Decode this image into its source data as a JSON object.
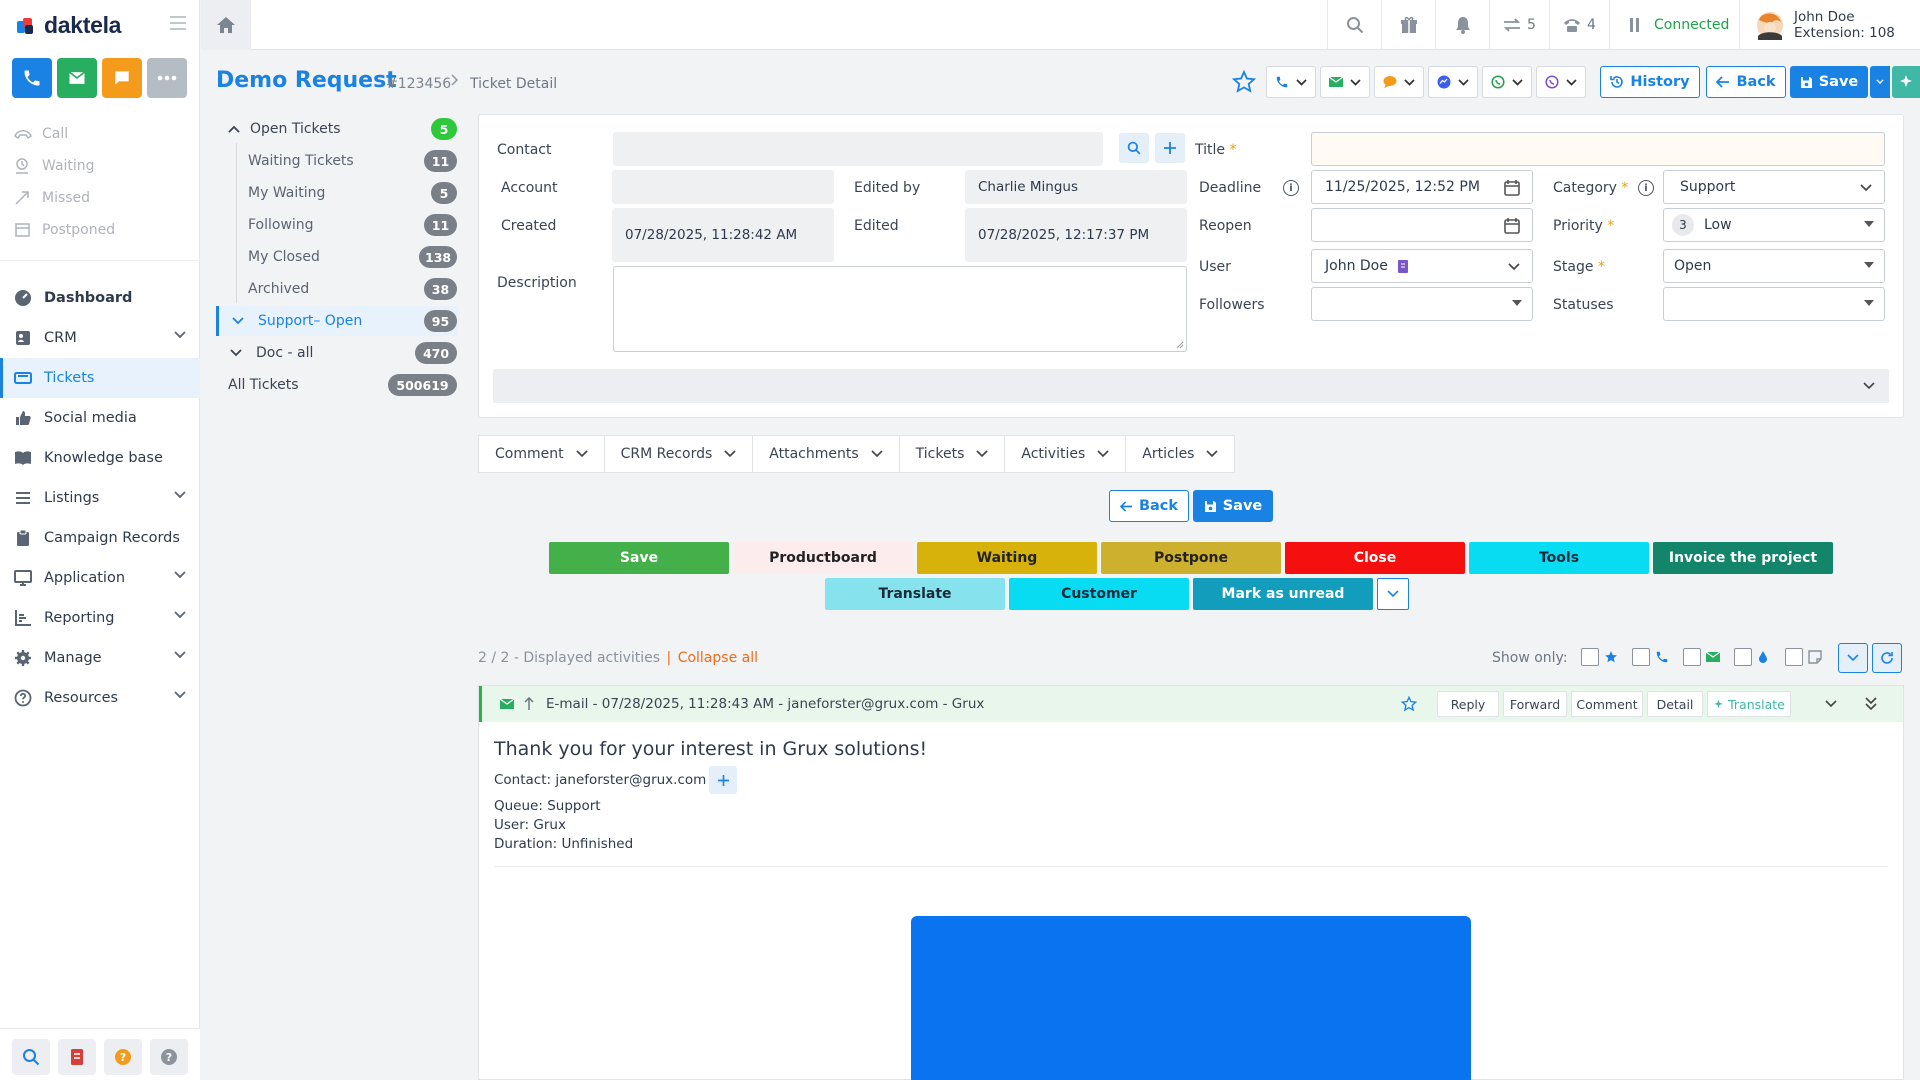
{
  "app": {
    "name": "daktela"
  },
  "sidebar": {
    "old_items": [
      {
        "label": "Call"
      },
      {
        "label": "Waiting"
      },
      {
        "label": "Missed"
      },
      {
        "label": "Postponed"
      }
    ],
    "nav": [
      {
        "label": "Dashboard",
        "icon": "dashboard-icon",
        "expandable": false
      },
      {
        "label": "CRM",
        "icon": "contact-card-icon",
        "expandable": true
      },
      {
        "label": "Tickets",
        "icon": "ticket-icon",
        "expandable": false,
        "active": true
      },
      {
        "label": "Social media",
        "icon": "thumbs-up-icon",
        "expandable": false
      },
      {
        "label": "Knowledge base",
        "icon": "book-icon",
        "expandable": false
      },
      {
        "label": "Listings",
        "icon": "list-icon",
        "expandable": true
      },
      {
        "label": "Campaign Records",
        "icon": "clipboard-icon",
        "expandable": false
      },
      {
        "label": "Application",
        "icon": "monitor-icon",
        "expandable": true
      },
      {
        "label": "Reporting",
        "icon": "chart-icon",
        "expandable": true
      },
      {
        "label": "Manage",
        "icon": "gear-icon",
        "expandable": true
      },
      {
        "label": "Resources",
        "icon": "help-circle-icon",
        "expandable": true
      }
    ]
  },
  "topbar": {
    "transfers_count": "5",
    "calls_count": "4",
    "status": "Connected",
    "user_name": "John Doe",
    "extension": "Extension: 108"
  },
  "page": {
    "title": "Demo Request",
    "ticket_number": "#123456",
    "breadcrumb": "Ticket Detail",
    "history_label": "History",
    "back_label": "Back",
    "save_label": "Save"
  },
  "ticket_tree": [
    {
      "label": "Open Tickets",
      "count": "5"
    },
    {
      "label": "Waiting Tickets",
      "count": "11"
    },
    {
      "label": "My Waiting",
      "count": "5"
    },
    {
      "label": "Following",
      "count": "11"
    },
    {
      "label": "My Closed",
      "count": "138"
    },
    {
      "label": "Archived",
      "count": "38"
    },
    {
      "label": "Support– Open",
      "count": "95"
    },
    {
      "label": "Doc - all",
      "count": "470"
    },
    {
      "label": "All Tickets",
      "count": "500619"
    }
  ],
  "form": {
    "contact_label": "Contact",
    "contact_value": "",
    "account_label": "Account",
    "account_value": "",
    "created_label": "Created",
    "created_value": "07/28/2025, 11:28:42 AM",
    "description_label": "Description",
    "edited_by_label": "Edited by",
    "edited_by_value": "Charlie Mingus",
    "edited_label": "Edited",
    "edited_value": "07/28/2025, 12:17:37 PM",
    "title_label": "Title",
    "title_value": "",
    "deadline_label": "Deadline",
    "deadline_value": "11/25/2025, 12:52 PM",
    "reopen_label": "Reopen",
    "reopen_value": "",
    "user_label": "User",
    "user_value": "John Doe",
    "followers_label": "Followers",
    "category_label": "Category",
    "category_value": "Support",
    "priority_label": "Priority",
    "priority_number": "3",
    "priority_value": "Low",
    "stage_label": "Stage",
    "stage_value": "Open",
    "statuses_label": "Statuses"
  },
  "tabs": [
    {
      "label": "Comment"
    },
    {
      "label": "CRM Records"
    },
    {
      "label": "Attachments"
    },
    {
      "label": "Tickets"
    },
    {
      "label": "Activities"
    },
    {
      "label": "Articles"
    }
  ],
  "actions": {
    "back_label": "Back",
    "save_label": "Save",
    "row1": [
      {
        "label": "Save",
        "bg": "#44b04a",
        "fg": "#ffffff"
      },
      {
        "label": "Productboard",
        "bg": "#fdeced",
        "fg": "#222222"
      },
      {
        "label": "Waiting",
        "bg": "#d6b20a",
        "fg": "#222222"
      },
      {
        "label": "Postpone",
        "bg": "#cdb02d",
        "fg": "#222222"
      },
      {
        "label": "Close",
        "bg": "#f50f0f",
        "fg": "#ffffff"
      },
      {
        "label": "Tools",
        "bg": "#08dcf2",
        "fg": "#1a2a3a"
      },
      {
        "label": "Invoice the project",
        "bg": "#12856b",
        "fg": "#ffffff"
      }
    ],
    "row2": [
      {
        "label": "Translate",
        "bg": "#86e3ee",
        "fg": "#1a2a3a"
      },
      {
        "label": "Customer",
        "bg": "#08dcf2",
        "fg": "#1a2a3a"
      },
      {
        "label": "Mark as unread",
        "bg": "#129dbd",
        "fg": "#ffffff"
      }
    ]
  },
  "activities": {
    "count_text": "2 / 2 - Displayed activities",
    "separator": "|",
    "collapse_label": "Collapse all",
    "show_only_label": "Show only:",
    "email_header": "E-mail - 07/28/2025, 11:28:43 AM - janeforster@grux.com - Grux",
    "header_buttons": [
      "Reply",
      "Forward",
      "Comment",
      "Detail",
      "Translate"
    ],
    "subject": "Thank you for your interest in Grux solutions!",
    "contact_line": "Contact: janeforster@grux.com",
    "queue_line": "Queue: Support",
    "user_line": "User: Grux",
    "duration_line": "Duration: Unfinished"
  },
  "colors": {
    "primary": "#1a82e2",
    "success": "#1ea34a",
    "green_button": "#27ae60",
    "orange_button": "#f59b1c",
    "collapse_link": "#ef6c1a",
    "email_banner": "#0a74f0"
  }
}
